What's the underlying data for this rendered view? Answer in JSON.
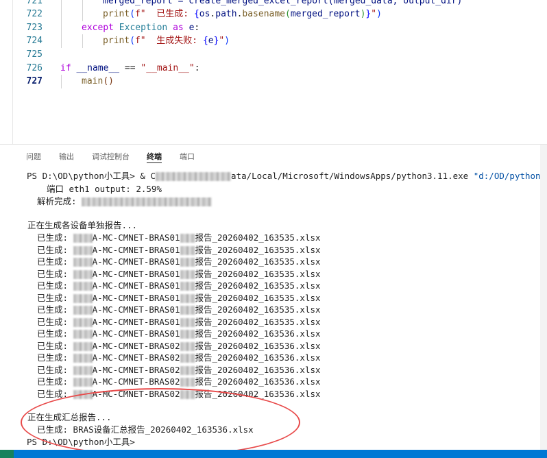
{
  "editor": {
    "lines": [
      {
        "num": "721",
        "indent": 2,
        "tokens": [
          {
            "t": "merged_report = create_merged_excel_report(merged_data, output_dir)",
            "c": "var"
          }
        ]
      },
      {
        "num": "722",
        "indent": 2,
        "tokens": [
          {
            "t": "print",
            "c": "fn"
          },
          {
            "t": "(",
            "c": "brk1"
          },
          {
            "t": "f\"  已生成: ",
            "c": "str"
          },
          {
            "t": "{",
            "c": "kw2"
          },
          {
            "t": "os",
            "c": "var"
          },
          {
            "t": ".",
            "c": ""
          },
          {
            "t": "path",
            "c": "var"
          },
          {
            "t": ".",
            "c": ""
          },
          {
            "t": "basename",
            "c": "fn"
          },
          {
            "t": "(",
            "c": "brk2"
          },
          {
            "t": "merged_report",
            "c": "var"
          },
          {
            "t": ")",
            "c": "brk2"
          },
          {
            "t": "}",
            "c": "kw2"
          },
          {
            "t": "\"",
            "c": "str"
          },
          {
            "t": ")",
            "c": "brk1"
          }
        ]
      },
      {
        "num": "723",
        "indent": 1,
        "tokens": [
          {
            "t": "except ",
            "c": "kw"
          },
          {
            "t": "Exception",
            "c": "cls"
          },
          {
            "t": " as ",
            "c": "kw"
          },
          {
            "t": "e",
            "c": "var"
          },
          {
            "t": ":",
            "c": ""
          }
        ]
      },
      {
        "num": "724",
        "indent": 2,
        "tokens": [
          {
            "t": "print",
            "c": "fn"
          },
          {
            "t": "(",
            "c": "brk1"
          },
          {
            "t": "f\"  生成失败: ",
            "c": "str"
          },
          {
            "t": "{",
            "c": "kw2"
          },
          {
            "t": "e",
            "c": "var"
          },
          {
            "t": "}",
            "c": "kw2"
          },
          {
            "t": "\"",
            "c": "str"
          },
          {
            "t": ")",
            "c": "brk1"
          }
        ]
      },
      {
        "num": "725",
        "indent": 0,
        "tokens": []
      },
      {
        "num": "726",
        "indent": 0,
        "tokens": [
          {
            "t": "if ",
            "c": "kw"
          },
          {
            "t": "__name__",
            "c": "var"
          },
          {
            "t": " == ",
            "c": ""
          },
          {
            "t": "\"__main__\"",
            "c": "str"
          },
          {
            "t": ":",
            "c": ""
          }
        ]
      },
      {
        "num": "727",
        "indent": 1,
        "active": true,
        "tokens": [
          {
            "t": "main",
            "c": "fn"
          },
          {
            "t": "(",
            "c": "brk3"
          },
          {
            "t": ")",
            "c": "brk3"
          }
        ]
      }
    ]
  },
  "panel": {
    "tabs": [
      {
        "label": "问题",
        "name": "tab-problems"
      },
      {
        "label": "输出",
        "name": "tab-output"
      },
      {
        "label": "调试控制台",
        "name": "tab-debug-console"
      },
      {
        "label": "终端",
        "name": "tab-terminal",
        "active": true
      },
      {
        "label": "端口",
        "name": "tab-ports"
      }
    ],
    "command": {
      "prompt": "PS D:\\OD\\python小工具> & C",
      "visible_path": "ata/Local/Microsoft/WindowsApps/python3.11.exe",
      "arg": "\"d:/OD/python"
    },
    "port_line": "端口 eth1 output: 2.59%",
    "parse_done": "解析完成: ",
    "generating_each": "正在生成各设备单独报告...",
    "reports": [
      {
        "prefix": "已生成: ",
        "mid": "A-MC-CMNET-BRAS01",
        "suffix": "报告_20260402_163535.xlsx"
      },
      {
        "prefix": "已生成: ",
        "mid": "A-MC-CMNET-BRAS01",
        "suffix": "报告_20260402_163535.xlsx"
      },
      {
        "prefix": "已生成: ",
        "mid": "A-MC-CMNET-BRAS01",
        "suffix": "报告_20260402_163535.xlsx"
      },
      {
        "prefix": "已生成: ",
        "mid": "A-MC-CMNET-BRAS01",
        "suffix": "报告_20260402_163535.xlsx"
      },
      {
        "prefix": "已生成: ",
        "mid": "A-MC-CMNET-BRAS01",
        "suffix": "报告_20260402_163535.xlsx"
      },
      {
        "prefix": "已生成: ",
        "mid": "A-MC-CMNET-BRAS01",
        "suffix": "报告_20260402_163535.xlsx"
      },
      {
        "prefix": "已生成: ",
        "mid": "A-MC-CMNET-BRAS01",
        "suffix": "报告_20260402_163535.xlsx"
      },
      {
        "prefix": "已生成: ",
        "mid": "A-MC-CMNET-BRAS01",
        "suffix": "报告_20260402_163535.xlsx"
      },
      {
        "prefix": "已生成: ",
        "mid": "A-MC-CMNET-BRAS01",
        "suffix": "报告_20260402_163536.xlsx"
      },
      {
        "prefix": "已生成: ",
        "mid": "A-MC-CMNET-BRAS02",
        "suffix": "报告_20260402_163536.xlsx"
      },
      {
        "prefix": "已生成: ",
        "mid": "A-MC-CMNET-BRAS02",
        "suffix": "报告_20260402_163536.xlsx"
      },
      {
        "prefix": "已生成: ",
        "mid": "A-MC-CMNET-BRAS02",
        "suffix": "报告_20260402_163536.xlsx"
      },
      {
        "prefix": "已生成: ",
        "mid": "A-MC-CMNET-BRAS02",
        "suffix": "报告_20260402_163536.xlsx"
      },
      {
        "prefix": "已生成: ",
        "mid": "A-MC-CMNET-BRAS02",
        "suffix": "报告_20260402_163536.xlsx"
      }
    ],
    "generating_summary": "正在生成汇总报告...",
    "summary_done": "已生成: BRAS设备汇总报告_20260402_163536.xlsx",
    "final_prompt": "PS D:\\OD\\python小工具>"
  },
  "colors": {
    "annotation": "#e84a4a",
    "statusbar": "#0078d4"
  }
}
